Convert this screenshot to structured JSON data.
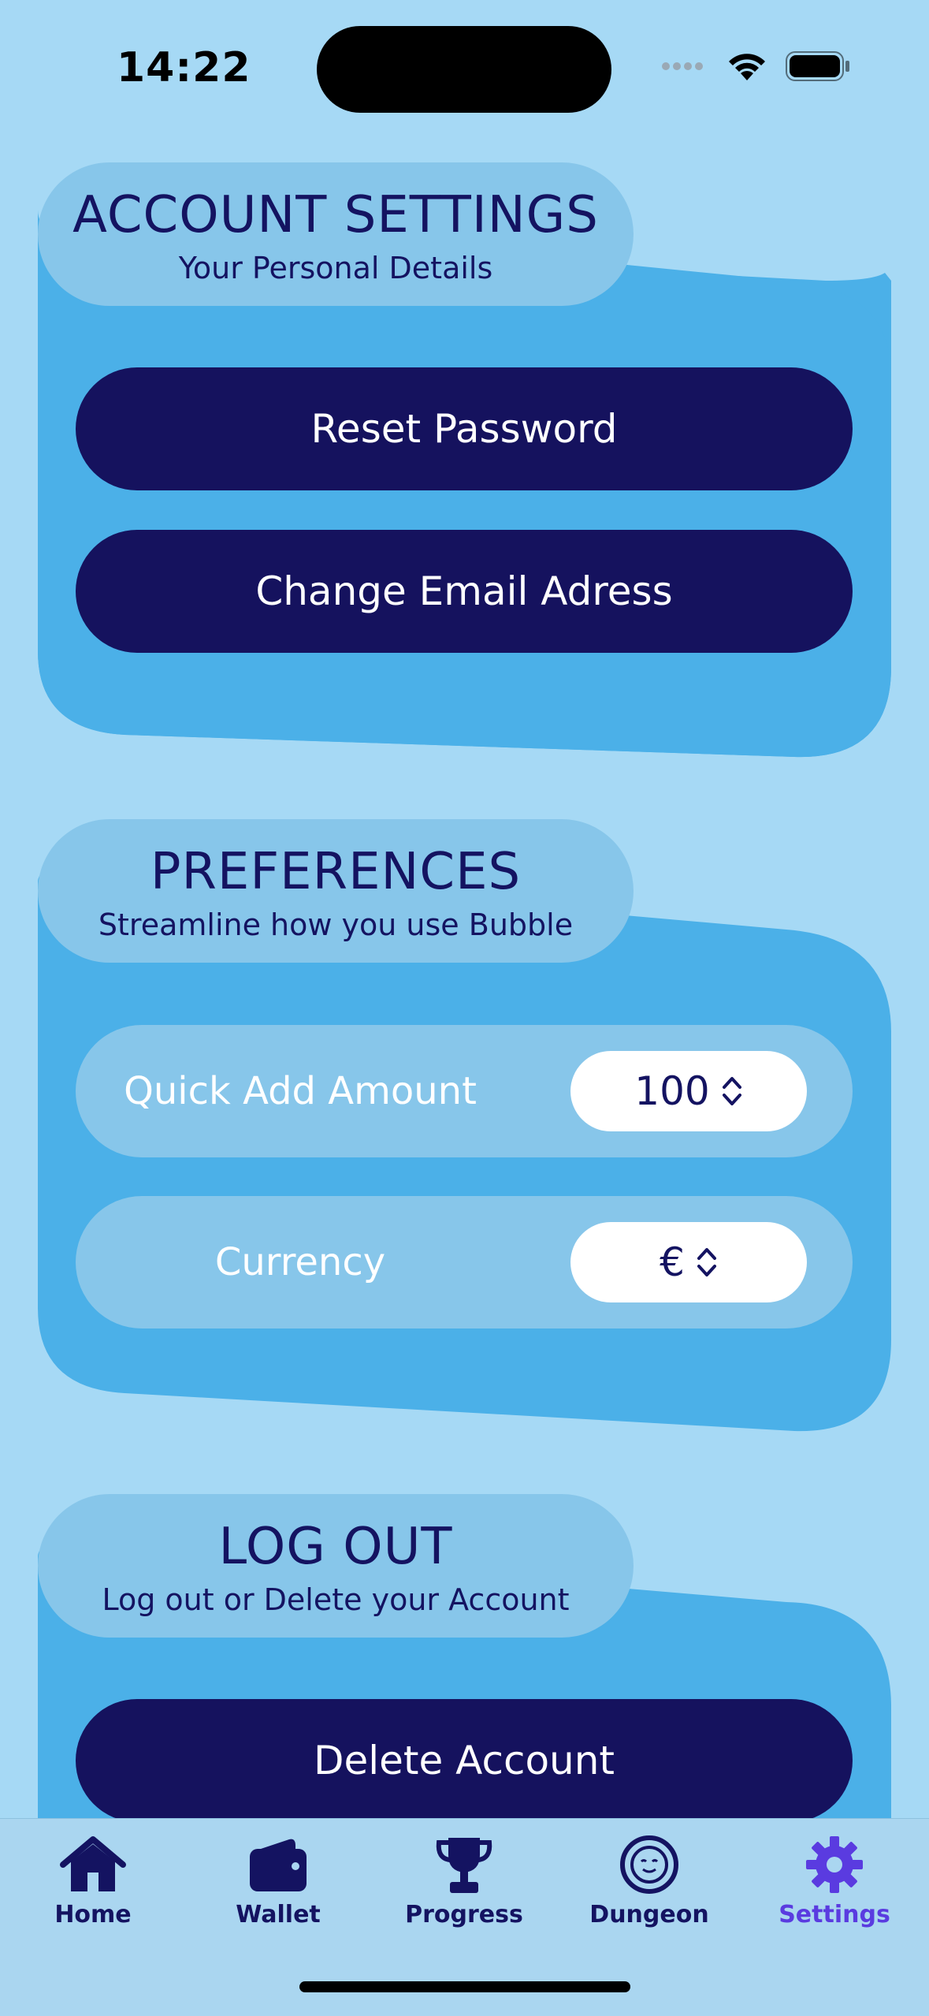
{
  "status_bar": {
    "time": "14:22"
  },
  "account_settings": {
    "title": "ACCOUNT SETTINGS",
    "subtitle": "Your Personal Details",
    "reset_password_label": "Reset Password",
    "change_email_label": "Change Email Adress"
  },
  "preferences": {
    "title": "PREFERENCES",
    "subtitle": "Streamline how you use Bubble",
    "quick_add": {
      "label": "Quick Add Amount",
      "value": "100"
    },
    "currency": {
      "label": "Currency",
      "value": "€"
    }
  },
  "logout": {
    "title": "LOG OUT",
    "subtitle": "Log out or Delete your Account",
    "delete_account_label": "Delete Account"
  },
  "tabbar": {
    "items": [
      {
        "label": "Home",
        "icon": "house-icon"
      },
      {
        "label": "Wallet",
        "icon": "wallet-icon"
      },
      {
        "label": "Progress",
        "icon": "trophy-icon"
      },
      {
        "label": "Dungeon",
        "icon": "face-icon"
      },
      {
        "label": "Settings",
        "icon": "gear-icon",
        "active": true
      }
    ]
  },
  "colors": {
    "background": "#A6D9F5",
    "card": "#4BB0E8",
    "pill": "#87C6EA",
    "button": "#15125E",
    "active_tab": "#5A3BE0"
  }
}
